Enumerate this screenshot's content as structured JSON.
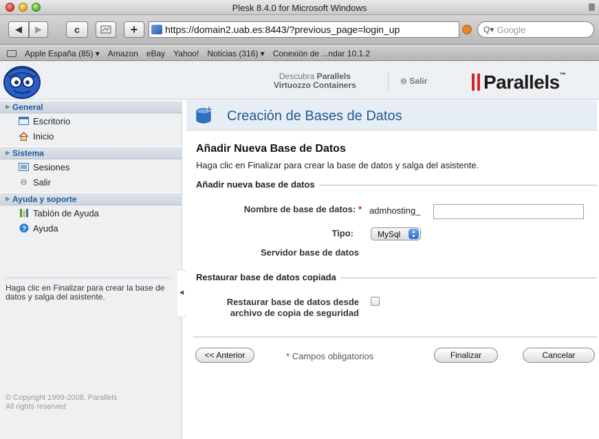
{
  "window": {
    "title": "Plesk 8.4.0 for Microsoft Windows"
  },
  "toolbar": {
    "url": "https://domain2.uab.es:8443/?previous_page=login_up",
    "search_placeholder": "Google",
    "back_icon": "◀",
    "forward_icon": "▶",
    "reload_icon": "c",
    "add_icon": "+"
  },
  "bookmarks": [
    "Apple España (85) ▾",
    "Amazon",
    "eBay",
    "Yahoo!",
    "Noticias (316) ▾",
    "Conexión de ...ndar 10.1.2"
  ],
  "header": {
    "promo_line1_prefix": "Descubra",
    "promo_line1_bold": "Parallels",
    "promo_line2": "Virtuozzo Containers",
    "logout": "Salir",
    "brand": "Parallels",
    "brand_colors": {
      "bars": "#d8232a",
      "text": "#1b1b1b"
    }
  },
  "sidebar": {
    "sections": [
      {
        "title": "General",
        "items": [
          {
            "label": "Escritorio",
            "icon": "desktop-icon"
          },
          {
            "label": "Inicio",
            "icon": "home-icon"
          }
        ]
      },
      {
        "title": "Sistema",
        "items": [
          {
            "label": "Sesiones",
            "icon": "sessions-icon"
          },
          {
            "label": "Salir",
            "icon": "logout-icon"
          }
        ]
      },
      {
        "title": "Ayuda y soporte",
        "items": [
          {
            "label": "Tablón de Ayuda",
            "icon": "helpdesk-icon"
          },
          {
            "label": "Ayuda",
            "icon": "help-icon"
          }
        ]
      }
    ],
    "hint": "Haga clic en Finalizar para crear la base de datos y salga del asistente.",
    "copyright_line1": "© Copyright 1999-2008, Parallels",
    "copyright_line2": "All rights reserved"
  },
  "main": {
    "page_title": "Creación de Bases de Datos",
    "section_title": "Añadir Nueva Base de Datos",
    "section_desc": "Haga clic en Finalizar para crear la base de datos y salga del asistente.",
    "fieldset1_legend": "Añadir nueva base de datos",
    "db_name_label": "Nombre de base de datos:",
    "required_mark": "*",
    "db_name_prefix": "admhosting_",
    "db_name_value": "",
    "type_label": "Tipo:",
    "type_selected": "MySql",
    "server_label": "Servidor base de datos",
    "fieldset2_legend": "Restaurar base de datos copiada",
    "restore_label_line1": "Restaurar base de datos desde",
    "restore_label_line2": "archivo de copia de seguridad",
    "restore_checked": false,
    "prev_button": "<< Anterior",
    "required_note": "Campos obligatorios",
    "finish_button": "Finalizar",
    "cancel_button": "Cancelar",
    "accent_color": "#245a8f"
  }
}
